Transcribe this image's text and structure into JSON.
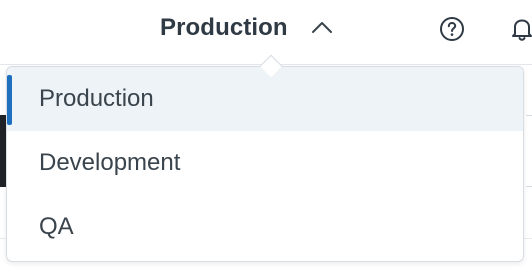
{
  "header": {
    "environment_title": "Production",
    "chevron_icon": "chevron-up-icon",
    "help_icon": "help-circle-icon",
    "notifications_icon": "bell-icon"
  },
  "dropdown": {
    "options": [
      {
        "label": "Production",
        "selected": true
      },
      {
        "label": "Development",
        "selected": false
      },
      {
        "label": "QA",
        "selected": false
      }
    ]
  },
  "colors": {
    "text": "#2f3a44",
    "selected_bg": "#eef3f7",
    "selected_bar": "#1f6fbf",
    "border": "#d8dde3"
  }
}
